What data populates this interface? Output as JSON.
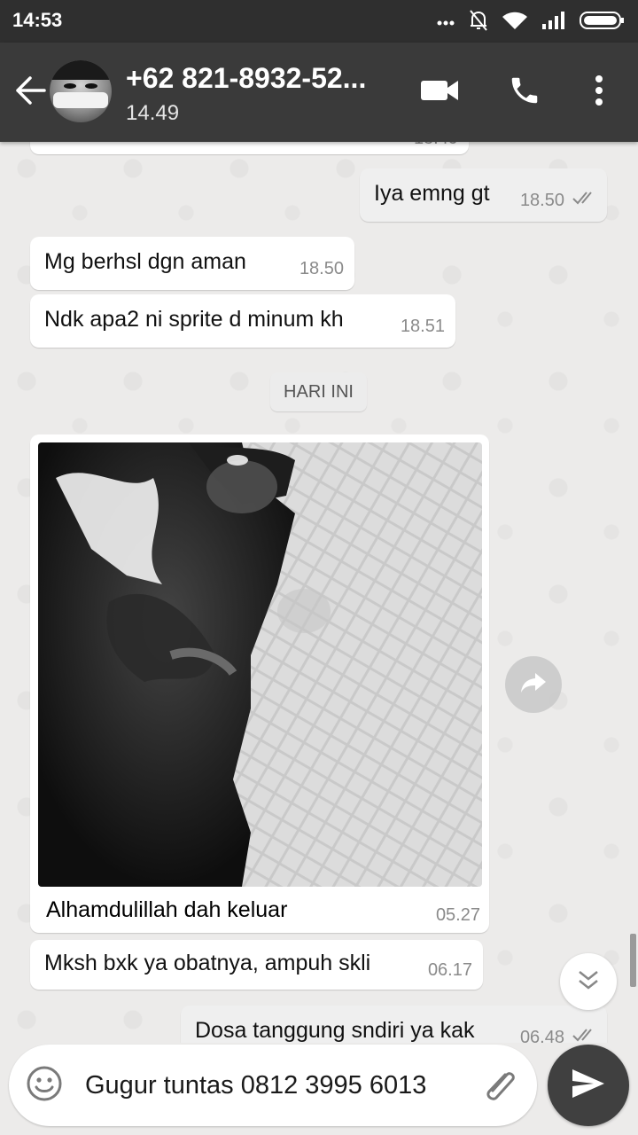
{
  "status_bar": {
    "time": "14:53",
    "icons": [
      "more-dots-icon",
      "bell-off-icon",
      "wifi-icon",
      "signal-icon",
      "battery-icon"
    ]
  },
  "header": {
    "contact_name": "+62 821-8932-52...",
    "last_seen": "14.49",
    "icons": [
      "back-arrow-icon",
      "video-call-icon",
      "phone-icon",
      "overflow-menu-icon"
    ]
  },
  "messages": [
    {
      "id": "m0",
      "direction": "in",
      "text": "",
      "time": "18.49"
    },
    {
      "id": "m1",
      "direction": "out",
      "text": "Iya emng gt",
      "time": "18.50",
      "ticks": "double"
    },
    {
      "id": "m2",
      "direction": "in",
      "text": "Mg  berhsl dgn aman",
      "time": "18.50"
    },
    {
      "id": "m3",
      "direction": "in",
      "text": "Ndk apa2 ni sprite d minum kh",
      "time": "18.51"
    },
    {
      "id": "m5",
      "direction": "in",
      "type": "image",
      "caption": "Alhamdulillah dah keluar",
      "time": "05.27"
    },
    {
      "id": "m6",
      "direction": "in",
      "text": "Mksh bxk ya obatnya, ampuh skli",
      "time": "06.17"
    },
    {
      "id": "m7",
      "direction": "out",
      "text": "Dosa tanggung sndiri ya kak",
      "time": "06.48",
      "ticks": "double"
    }
  ],
  "date_separator": "HARI INI",
  "composer": {
    "text": "Gugur tuntas 0812 3995 6013",
    "icons": [
      "emoji-icon",
      "attach-icon",
      "send-icon"
    ]
  },
  "colors": {
    "status_bar": "#2f2f2f",
    "header": "#3a3a3a",
    "chat_bg": "#ecebea",
    "send_button": "#404040"
  }
}
